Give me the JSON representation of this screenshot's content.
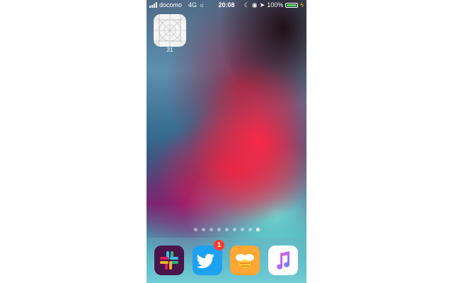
{
  "status_bar": {
    "carrier": "docomo",
    "network": "4G",
    "time": "20:08",
    "battery_percent": "100%",
    "battery_level": 1.0,
    "icons": [
      "signal-icon",
      "brightness-icon",
      "moon-icon",
      "rotation-lock-icon",
      "location-icon",
      "battery-icon",
      "charging-icon"
    ]
  },
  "home": {
    "apps": [
      {
        "label": "31",
        "icon": "placeholder-app-icon"
      }
    ],
    "page_dots": {
      "count": 9,
      "active_index": 8
    }
  },
  "dock": {
    "apps": [
      {
        "name": "slack",
        "icon": "slack-icon"
      },
      {
        "name": "twitter",
        "icon": "twitter-icon",
        "badge": "1"
      },
      {
        "name": "swarm",
        "icon": "swarm-icon"
      },
      {
        "name": "music",
        "icon": "music-icon"
      }
    ]
  },
  "colors": {
    "badge": "#ff3b30",
    "battery_fill": "#4cd964",
    "twitter": "#1da1f2",
    "swarm": "#ffa633",
    "slack_bg": "#4a154b"
  }
}
